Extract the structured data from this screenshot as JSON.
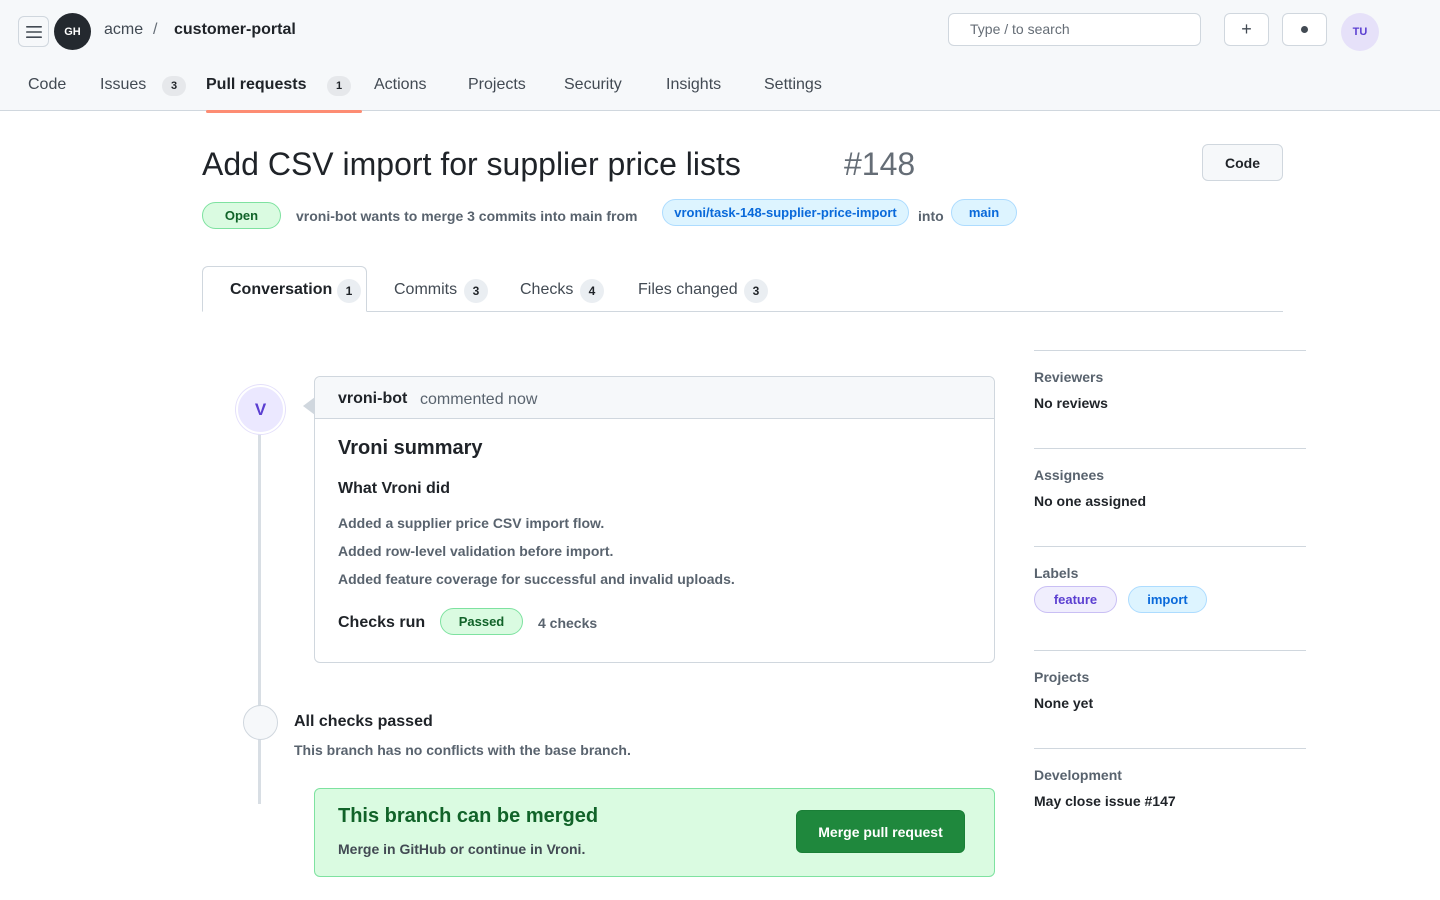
{
  "header": {
    "org_avatar": "GH",
    "owner": "acme",
    "separator": "/",
    "repo": "customer-portal",
    "search_placeholder": "Type / to search",
    "plus_icon": "+",
    "user_avatar": "TU"
  },
  "repo_nav": {
    "code": "Code",
    "issues": "Issues",
    "issues_count": "3",
    "pull_requests": "Pull requests",
    "pull_requests_count": "1",
    "actions": "Actions",
    "projects": "Projects",
    "security": "Security",
    "insights": "Insights",
    "settings": "Settings"
  },
  "pr": {
    "title": "Add CSV import for supplier price lists",
    "number": "#148",
    "code_button": "Code",
    "state": "Open",
    "meta_text": "vroni-bot wants to merge 3 commits into main from",
    "head_branch": "vroni/task-148-supplier-price-import",
    "into_text": "into",
    "base_branch": "main"
  },
  "tabs": [
    {
      "label": "Conversation",
      "count": "1"
    },
    {
      "label": "Commits",
      "count": "3"
    },
    {
      "label": "Checks",
      "count": "4"
    },
    {
      "label": "Files changed",
      "count": "3"
    }
  ],
  "comment": {
    "avatar_letter": "V",
    "author": "vroni-bot",
    "time": "commented now",
    "heading": "Vroni summary",
    "subheading": "What Vroni did",
    "lines": [
      "Added a supplier price CSV import flow.",
      "Added row-level validation before import.",
      "Added feature coverage for successful and invalid uploads."
    ],
    "checks_label": "Checks run",
    "checks_status": "Passed",
    "checks_count": "4 checks"
  },
  "checks_event": {
    "title": "All checks passed",
    "subtitle": "This branch has no conflicts with the base branch."
  },
  "merge": {
    "title": "This branch can be merged",
    "subtitle": "Merge in GitHub or continue in Vroni.",
    "button": "Merge pull request"
  },
  "sidebar": {
    "reviewers_title": "Reviewers",
    "reviewers_value": "No reviews",
    "assignees_title": "Assignees",
    "assignees_value": "No one assigned",
    "labels_title": "Labels",
    "labels": [
      "feature",
      "import"
    ],
    "projects_title": "Projects",
    "projects_value": "None yet",
    "development_title": "Development",
    "development_value": "May close issue #147"
  },
  "colors": {
    "accent_underline": "#fd8c73",
    "open_green": "#116329",
    "merge_button": "#1f883d",
    "branch_blue": "#0969da",
    "bot_purple": "#5b3fd1"
  }
}
